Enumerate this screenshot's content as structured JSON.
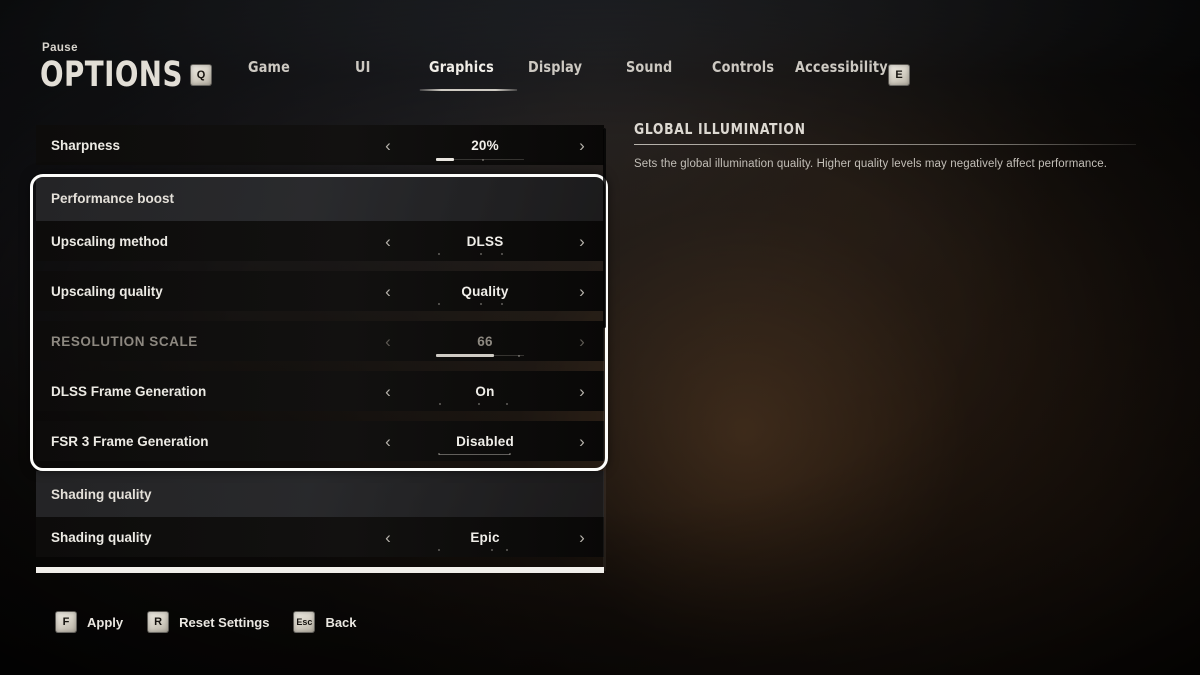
{
  "header": {
    "eyebrow": "Pause",
    "title": "OPTIONS",
    "prev_key": "Q",
    "next_key": "E"
  },
  "tabs": [
    {
      "label": "Game",
      "active": false
    },
    {
      "label": "UI",
      "active": false
    },
    {
      "label": "Graphics",
      "active": true
    },
    {
      "label": "Display",
      "active": false
    },
    {
      "label": "Sound",
      "active": false
    },
    {
      "label": "Controls",
      "active": false
    },
    {
      "label": "Accessibility",
      "active": false
    }
  ],
  "settings": {
    "top_row": {
      "label": "Sharpness",
      "value": "20%",
      "left_arrow": "‹",
      "right_arrow": "›",
      "slider_percent": 20
    },
    "group": {
      "heading": "Performance boost",
      "rows": [
        {
          "label": "Upscaling method",
          "value": "DLSS",
          "left_arrow": "‹",
          "right_arrow": "›",
          "indicator": "dots",
          "dot_count": 3,
          "disabled": false
        },
        {
          "label": "Upscaling quality",
          "value": "Quality",
          "left_arrow": "‹",
          "right_arrow": "›",
          "indicator": "dots",
          "dot_count": 3,
          "disabled": false
        },
        {
          "label": "RESOLUTION SCALE",
          "value": "66",
          "left_arrow": "‹",
          "right_arrow": "›",
          "indicator": "slider",
          "slider_percent": 66,
          "disabled": true
        },
        {
          "label": "DLSS Frame Generation",
          "value": "On",
          "left_arrow": "‹",
          "right_arrow": "›",
          "indicator": "dots",
          "dot_count": 3,
          "disabled": false
        },
        {
          "label": "FSR 3 Frame Generation",
          "value": "Disabled",
          "left_arrow": "‹",
          "right_arrow": "›",
          "indicator": "segment",
          "dot_count": 2,
          "disabled": false
        }
      ]
    },
    "group2": {
      "heading": "Shading quality",
      "rows": [
        {
          "label": "Shading quality",
          "value": "Epic",
          "left_arrow": "‹",
          "right_arrow": "›",
          "indicator": "dots",
          "dot_count": 3,
          "disabled": false
        }
      ]
    }
  },
  "info": {
    "title": "GLOBAL ILLUMINATION",
    "description": "Sets the global illumination quality. Higher quality levels may negatively affect performance."
  },
  "footer": [
    {
      "key": "F",
      "label": "Apply"
    },
    {
      "key": "R",
      "label": "Reset Settings"
    },
    {
      "key": "Esc",
      "label": "Back"
    }
  ],
  "colors": {
    "accent": "#fdfdfb",
    "text": "#eceae4",
    "text_dim": "#8d8880",
    "row_bg": "#0d0c0b",
    "selected": "#f4f2ee"
  }
}
